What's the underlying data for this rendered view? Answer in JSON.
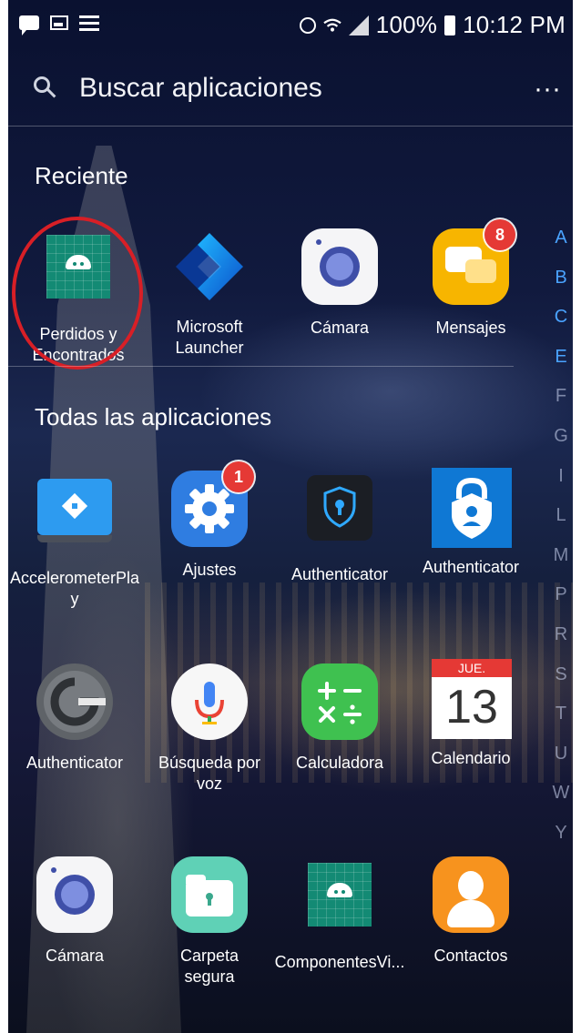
{
  "status_bar": {
    "battery": "100%",
    "time": "10:12 PM",
    "left_icons": [
      "chat-icon",
      "image-icon",
      "list-icon"
    ],
    "right_icons": [
      "alarm-icon",
      "wifi-icon",
      "signal-icon",
      "battery-icon"
    ]
  },
  "search": {
    "placeholder": "Buscar aplicaciones",
    "menu_icon": "more-dots-icon",
    "more_glyph": "···"
  },
  "recent": {
    "title": "Reciente",
    "apps": [
      {
        "label": "Perdidos y\nEncontrados",
        "icon": "android-icon",
        "highlighted": true
      },
      {
        "label": "Microsoft\nLauncher",
        "icon": "microsoft-launcher-icon"
      },
      {
        "label": "Cámara",
        "icon": "camera-icon"
      },
      {
        "label": "Mensajes",
        "icon": "messages-icon",
        "badge": "8"
      }
    ]
  },
  "all_apps": {
    "title": "Todas las aplicaciones",
    "apps": [
      {
        "label": "AccelerometerPla\ny",
        "icon": "accelerometer-icon"
      },
      {
        "label": "Ajustes",
        "icon": "settings-icon",
        "badge": "1"
      },
      {
        "label": "Authenticator",
        "icon": "shield-lock-icon"
      },
      {
        "label": "Authenticator",
        "icon": "microsoft-authenticator-icon"
      },
      {
        "label": "Authenticator",
        "icon": "google-authenticator-icon"
      },
      {
        "label": "Búsqueda por\nvoz",
        "icon": "microphone-icon"
      },
      {
        "label": "Calculadora",
        "icon": "calculator-icon"
      },
      {
        "label": "Calendario",
        "icon": "calendar-icon",
        "calendar_day_name": "JUE.",
        "calendar_date": "13"
      },
      {
        "label": "Cámara",
        "icon": "camera-icon"
      },
      {
        "label": "Carpeta\nsegura",
        "icon": "secure-folder-icon"
      },
      {
        "label": "ComponentesVi...",
        "icon": "android-icon"
      },
      {
        "label": "Contactos",
        "icon": "contacts-icon"
      }
    ]
  },
  "alphabet_index": [
    "A",
    "B",
    "C",
    "E",
    "F",
    "G",
    "I",
    "L",
    "M",
    "P",
    "R",
    "S",
    "T",
    "U",
    "W",
    "Y"
  ],
  "alphabet_active": [
    "A",
    "B",
    "C",
    "E"
  ],
  "colors": {
    "highlight_ring": "#d81f26",
    "badge": "#e53935",
    "index_active": "#4aa3ff"
  }
}
